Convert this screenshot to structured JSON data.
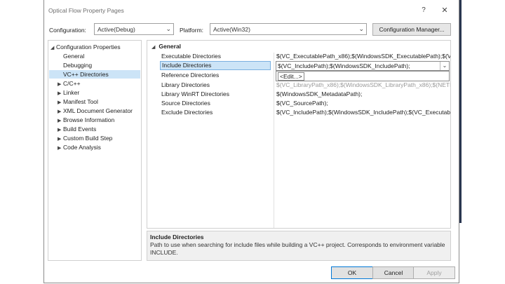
{
  "window": {
    "title": "Optical Flow Property Pages",
    "help_glyph": "?",
    "close_glyph": "✕"
  },
  "config": {
    "configuration_label": "Configuration:",
    "configuration_value": "Active(Debug)",
    "platform_label": "Platform:",
    "platform_value": "Active(Win32)",
    "manager_button": "Configuration Manager..."
  },
  "tree": {
    "root": "Configuration Properties",
    "items": [
      {
        "label": "General",
        "expander": ""
      },
      {
        "label": "Debugging",
        "expander": ""
      },
      {
        "label": "VC++ Directories",
        "expander": ""
      },
      {
        "label": "C/C++",
        "expander": "▶"
      },
      {
        "label": "Linker",
        "expander": "▶"
      },
      {
        "label": "Manifest Tool",
        "expander": "▶"
      },
      {
        "label": "XML Document Generator",
        "expander": "▶"
      },
      {
        "label": "Browse Information",
        "expander": "▶"
      },
      {
        "label": "Build Events",
        "expander": "▶"
      },
      {
        "label": "Custom Build Step",
        "expander": "▶"
      },
      {
        "label": "Code Analysis",
        "expander": "▶"
      }
    ]
  },
  "grid": {
    "category": "General",
    "rows": [
      {
        "name": "Executable Directories",
        "value": "$(VC_ExecutablePath_x86);$(WindowsSDK_ExecutablePath);$(VS_E"
      },
      {
        "name": "Include Directories",
        "value": ""
      },
      {
        "name": "Reference Directories",
        "value": ""
      },
      {
        "name": "Library Directories",
        "value": "$(VC_LibraryPath_x86);$(WindowsSDK_LibraryPath_x86);$(NETFX"
      },
      {
        "name": "Library WinRT Directories",
        "value": "$(WindowsSDK_MetadataPath);"
      },
      {
        "name": "Source Directories",
        "value": "$(VC_SourcePath);"
      },
      {
        "name": "Exclude Directories",
        "value": "$(VC_IncludePath);$(WindowsSDK_IncludePath);$(VC_Executable"
      }
    ],
    "edit_value": "$(VC_IncludePath);$(WindowsSDK_IncludePath);",
    "dropdown_option": "<Edit...>"
  },
  "description": {
    "title": "Include Directories",
    "text": "Path to use when searching for include files while building a VC++ project.  Corresponds to environment variable INCLUDE."
  },
  "buttons": {
    "ok": "OK",
    "cancel": "Cancel",
    "apply": "Apply"
  }
}
